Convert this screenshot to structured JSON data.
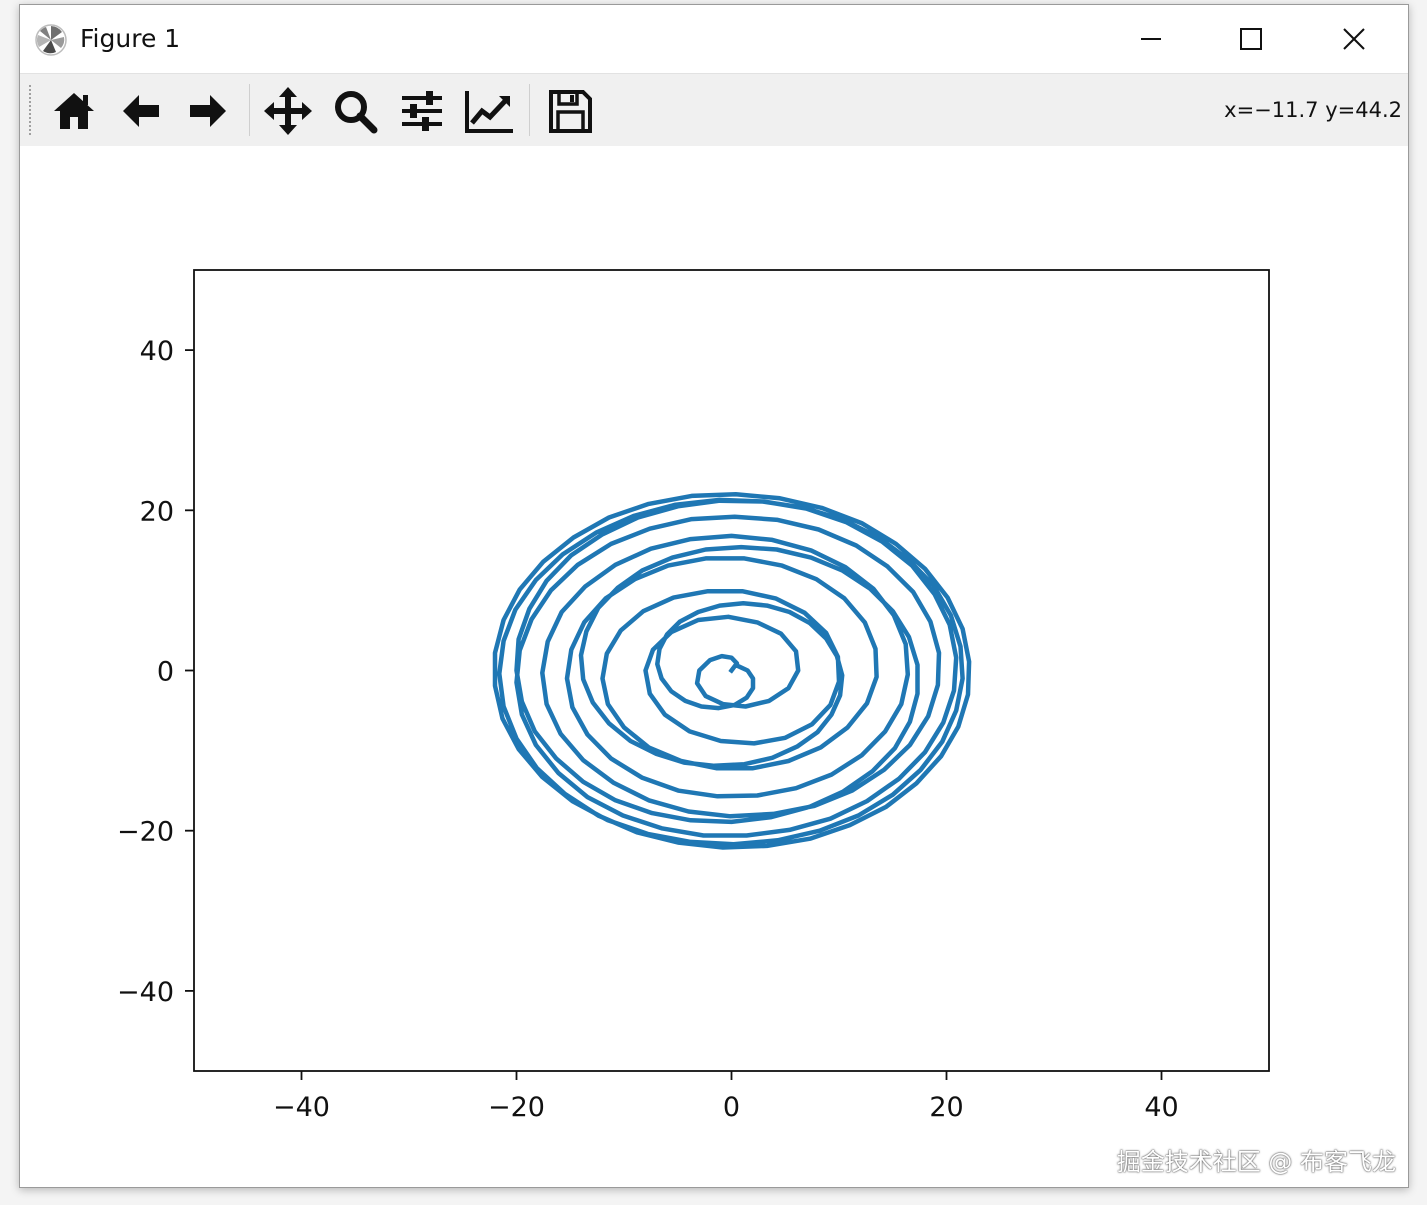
{
  "window": {
    "title": "Figure 1",
    "app_icon": "matplotlib-icon",
    "controls": {
      "minimize_icon": "minimize-icon",
      "maximize_icon": "maximize-icon",
      "close_icon": "close-icon"
    }
  },
  "toolbar": {
    "buttons": [
      {
        "name": "home-button",
        "icon": "home-icon"
      },
      {
        "name": "back-button",
        "icon": "arrow-left-icon"
      },
      {
        "name": "forward-button",
        "icon": "arrow-right-icon"
      },
      {
        "name": "pan-button",
        "icon": "move-icon"
      },
      {
        "name": "zoom-button",
        "icon": "magnifier-icon"
      },
      {
        "name": "configure-subplots-button",
        "icon": "sliders-icon"
      },
      {
        "name": "edit-axis-button",
        "icon": "line-chart-icon"
      },
      {
        "name": "save-button",
        "icon": "floppy-disk-icon"
      }
    ],
    "coordinates": "x=−11.7 y=44.2"
  },
  "chart_data": {
    "type": "line",
    "title": "",
    "xlabel": "",
    "ylabel": "",
    "xlim": [
      -50,
      50
    ],
    "ylim": [
      -50,
      50
    ],
    "xticks": [
      -40,
      -20,
      0,
      20,
      40
    ],
    "yticks": [
      -40,
      -20,
      0,
      20,
      40
    ],
    "xtick_labels": [
      "−40",
      "−20",
      "0",
      "20",
      "40"
    ],
    "ytick_labels": [
      "−40",
      "−20",
      "0",
      "20",
      "40"
    ],
    "grid": false,
    "line_color": "#1f77b4",
    "series": [
      {
        "description_type": "archimedean-spiral",
        "points": [
          [
            0.0,
            0.0
          ],
          [
            0.5,
            0.9
          ],
          [
            0.0,
            1.6
          ],
          [
            -0.9,
            1.8
          ],
          [
            -2.0,
            1.3
          ],
          [
            -3.0,
            0.0
          ],
          [
            -3.2,
            -1.6
          ],
          [
            -2.4,
            -3.2
          ],
          [
            -0.8,
            -4.2
          ],
          [
            1.3,
            -4.5
          ],
          [
            3.5,
            -3.8
          ],
          [
            5.3,
            -2.2
          ],
          [
            6.2,
            0.0
          ],
          [
            6.0,
            2.4
          ],
          [
            4.6,
            4.6
          ],
          [
            2.4,
            6.0
          ],
          [
            -0.3,
            6.7
          ],
          [
            -3.1,
            6.3
          ],
          [
            -5.6,
            4.8
          ],
          [
            -7.3,
            2.6
          ],
          [
            -8.0,
            0.0
          ],
          [
            -7.6,
            -2.9
          ],
          [
            -6.2,
            -5.5
          ],
          [
            -3.9,
            -7.6
          ],
          [
            -1.0,
            -8.8
          ],
          [
            2.1,
            -9.1
          ],
          [
            5.0,
            -8.4
          ],
          [
            7.5,
            -6.7
          ],
          [
            9.2,
            -4.3
          ],
          [
            10.0,
            -1.4
          ],
          [
            9.9,
            1.7
          ],
          [
            8.8,
            4.7
          ],
          [
            6.8,
            7.2
          ],
          [
            4.1,
            9.0
          ],
          [
            1.0,
            9.9
          ],
          [
            -2.2,
            9.9
          ],
          [
            -5.4,
            9.1
          ],
          [
            -8.2,
            7.4
          ],
          [
            -10.3,
            5.0
          ],
          [
            -11.6,
            2.1
          ],
          [
            -12.0,
            -1.0
          ],
          [
            -11.5,
            -4.2
          ],
          [
            -10.0,
            -7.1
          ],
          [
            -7.7,
            -9.6
          ],
          [
            -4.7,
            -11.3
          ],
          [
            -1.4,
            -12.2
          ],
          [
            2.0,
            -12.2
          ],
          [
            5.3,
            -11.3
          ],
          [
            8.3,
            -9.6
          ],
          [
            10.8,
            -7.1
          ],
          [
            12.6,
            -4.1
          ],
          [
            13.5,
            -0.8
          ],
          [
            13.4,
            2.7
          ],
          [
            12.4,
            6.0
          ],
          [
            10.5,
            9.0
          ],
          [
            7.9,
            11.4
          ],
          [
            4.7,
            13.1
          ],
          [
            1.2,
            14.0
          ],
          [
            -2.4,
            14.0
          ],
          [
            -5.9,
            13.1
          ],
          [
            -9.0,
            11.4
          ],
          [
            -11.7,
            9.0
          ],
          [
            -13.7,
            6.0
          ],
          [
            -14.9,
            2.6
          ],
          [
            -15.3,
            -1.0
          ],
          [
            -14.8,
            -4.6
          ],
          [
            -13.4,
            -8.0
          ],
          [
            -11.2,
            -11.0
          ],
          [
            -8.3,
            -13.4
          ],
          [
            -4.9,
            -15.0
          ],
          [
            -1.3,
            -15.7
          ],
          [
            2.4,
            -15.6
          ],
          [
            6.0,
            -14.7
          ],
          [
            9.3,
            -13.0
          ],
          [
            12.1,
            -10.6
          ],
          [
            14.3,
            -7.6
          ],
          [
            15.8,
            -4.2
          ],
          [
            16.4,
            -0.5
          ],
          [
            16.2,
            3.3
          ],
          [
            15.1,
            6.9
          ],
          [
            13.2,
            10.2
          ],
          [
            10.6,
            12.9
          ],
          [
            7.4,
            15.0
          ],
          [
            3.8,
            16.3
          ],
          [
            0.0,
            16.8
          ],
          [
            -3.8,
            16.4
          ],
          [
            -7.5,
            15.2
          ],
          [
            -10.8,
            13.2
          ],
          [
            -13.6,
            10.5
          ],
          [
            -15.8,
            7.3
          ],
          [
            -17.1,
            3.6
          ],
          [
            -17.6,
            -0.3
          ],
          [
            -17.2,
            -4.2
          ],
          [
            -15.9,
            -7.9
          ],
          [
            -13.8,
            -11.2
          ],
          [
            -11.0,
            -14.0
          ],
          [
            -7.7,
            -16.2
          ],
          [
            -4.0,
            -17.6
          ],
          [
            -0.1,
            -18.2
          ],
          [
            3.9,
            -17.9
          ],
          [
            7.7,
            -16.9
          ],
          [
            11.2,
            -15.0
          ],
          [
            14.2,
            -12.4
          ],
          [
            16.6,
            -9.3
          ],
          [
            18.3,
            -5.7
          ],
          [
            19.2,
            -1.8
          ],
          [
            19.3,
            2.2
          ],
          [
            18.5,
            6.1
          ],
          [
            16.9,
            9.8
          ],
          [
            14.5,
            13.0
          ],
          [
            11.6,
            15.6
          ],
          [
            8.1,
            17.6
          ],
          [
            4.3,
            18.8
          ],
          [
            0.3,
            19.2
          ],
          [
            -3.7,
            18.9
          ],
          [
            -7.6,
            17.7
          ],
          [
            -11.2,
            15.8
          ],
          [
            -14.3,
            13.2
          ],
          [
            -16.8,
            10.0
          ],
          [
            -18.6,
            6.4
          ],
          [
            -19.7,
            2.5
          ],
          [
            -20.0,
            -1.5
          ],
          [
            -19.5,
            -5.5
          ],
          [
            -18.2,
            -9.3
          ],
          [
            -16.1,
            -12.8
          ],
          [
            -13.4,
            -15.8
          ],
          [
            -10.1,
            -18.1
          ],
          [
            -6.5,
            -19.7
          ],
          [
            -2.6,
            -20.6
          ],
          [
            1.4,
            -20.6
          ],
          [
            5.4,
            -19.9
          ],
          [
            9.2,
            -18.5
          ],
          [
            12.6,
            -16.3
          ],
          [
            15.6,
            -13.5
          ],
          [
            18.0,
            -10.2
          ],
          [
            19.7,
            -6.5
          ],
          [
            20.7,
            -2.5
          ],
          [
            20.9,
            1.6
          ],
          [
            20.3,
            5.7
          ],
          [
            18.9,
            9.5
          ],
          [
            16.8,
            13.1
          ],
          [
            14.0,
            16.1
          ],
          [
            10.7,
            18.5
          ],
          [
            7.0,
            20.2
          ],
          [
            3.0,
            21.1
          ],
          [
            -1.1,
            21.3
          ],
          [
            -5.2,
            20.7
          ],
          [
            -9.1,
            19.3
          ],
          [
            -12.6,
            17.2
          ],
          [
            -15.7,
            14.5
          ],
          [
            -18.2,
            11.3
          ],
          [
            -20.1,
            7.6
          ],
          [
            -21.2,
            3.7
          ],
          [
            -21.6,
            -0.4
          ],
          [
            -21.2,
            -4.5
          ],
          [
            -20.0,
            -8.5
          ],
          [
            -18.1,
            -12.2
          ],
          [
            -15.5,
            -15.4
          ],
          [
            -12.4,
            -18.1
          ],
          [
            -8.8,
            -20.2
          ],
          [
            -4.9,
            -21.5
          ],
          [
            -0.8,
            -22.1
          ],
          [
            3.3,
            -21.9
          ],
          [
            7.3,
            -21.0
          ],
          [
            11.0,
            -19.3
          ],
          [
            14.4,
            -17.0
          ],
          [
            17.2,
            -14.1
          ],
          [
            19.5,
            -10.7
          ],
          [
            21.1,
            -7.0
          ],
          [
            22.0,
            -3.0
          ],
          [
            22.1,
            1.1
          ],
          [
            21.5,
            5.2
          ],
          [
            20.1,
            9.1
          ],
          [
            18.0,
            12.7
          ],
          [
            15.3,
            15.8
          ],
          [
            12.1,
            18.4
          ],
          [
            8.4,
            20.3
          ],
          [
            4.5,
            21.5
          ],
          [
            0.4,
            22.0
          ],
          [
            -3.7,
            21.8
          ],
          [
            -7.7,
            20.8
          ],
          [
            -11.4,
            19.1
          ],
          [
            -14.7,
            16.6
          ],
          [
            -17.5,
            13.6
          ],
          [
            -19.7,
            10.1
          ],
          [
            -21.2,
            6.3
          ],
          [
            -22.0,
            2.2
          ],
          [
            -22.0,
            -1.9
          ],
          [
            -21.3,
            -6.0
          ],
          [
            -19.8,
            -9.8
          ],
          [
            -17.6,
            -13.3
          ],
          [
            -14.8,
            -16.3
          ],
          [
            -11.5,
            -18.7
          ],
          [
            -7.8,
            -20.4
          ],
          [
            -3.8,
            -21.4
          ],
          [
            0.2,
            -21.7
          ],
          [
            4.3,
            -21.2
          ],
          [
            8.2,
            -20.0
          ],
          [
            11.8,
            -18.1
          ],
          [
            15.0,
            -15.5
          ],
          [
            17.6,
            -12.4
          ],
          [
            19.6,
            -8.9
          ],
          [
            20.9,
            -5.0
          ],
          [
            21.5,
            -1.0
          ],
          [
            21.3,
            3.0
          ],
          [
            20.4,
            6.9
          ],
          [
            18.8,
            10.6
          ],
          [
            16.5,
            13.8
          ],
          [
            13.7,
            16.6
          ],
          [
            10.4,
            18.8
          ],
          [
            6.8,
            20.3
          ],
          [
            2.9,
            21.1
          ],
          [
            -1.1,
            21.2
          ],
          [
            -5.0,
            20.5
          ],
          [
            -8.7,
            19.1
          ],
          [
            -12.0,
            17.0
          ],
          [
            -14.9,
            14.4
          ],
          [
            -17.2,
            11.2
          ],
          [
            -18.8,
            7.7
          ],
          [
            -19.8,
            3.9
          ],
          [
            -20.0,
            0.0
          ],
          [
            -19.5,
            -3.9
          ],
          [
            -18.3,
            -7.6
          ],
          [
            -16.3,
            -11.0
          ],
          [
            -13.8,
            -13.9
          ],
          [
            -10.8,
            -16.2
          ],
          [
            -7.4,
            -17.8
          ],
          [
            -3.8,
            -18.7
          ],
          [
            0.0,
            -18.9
          ],
          [
            3.7,
            -18.3
          ],
          [
            7.3,
            -17.0
          ],
          [
            10.4,
            -15.1
          ],
          [
            13.1,
            -12.6
          ],
          [
            15.2,
            -9.7
          ],
          [
            16.6,
            -6.4
          ],
          [
            17.3,
            -2.9
          ],
          [
            17.3,
            0.7
          ],
          [
            16.5,
            4.2
          ],
          [
            15.0,
            7.4
          ],
          [
            12.9,
            10.2
          ],
          [
            10.3,
            12.5
          ],
          [
            7.4,
            14.1
          ],
          [
            4.2,
            15.1
          ],
          [
            0.9,
            15.4
          ],
          [
            -2.4,
            15.1
          ],
          [
            -5.5,
            14.1
          ],
          [
            -8.3,
            12.5
          ],
          [
            -10.6,
            10.3
          ],
          [
            -12.4,
            7.8
          ],
          [
            -13.5,
            4.9
          ],
          [
            -14.0,
            1.9
          ],
          [
            -13.8,
            -1.1
          ],
          [
            -12.9,
            -4.0
          ],
          [
            -11.4,
            -6.6
          ],
          [
            -9.4,
            -8.8
          ],
          [
            -7.0,
            -10.4
          ],
          [
            -4.4,
            -11.5
          ],
          [
            -1.6,
            -11.9
          ],
          [
            1.2,
            -11.7
          ],
          [
            3.8,
            -10.9
          ],
          [
            6.1,
            -9.5
          ],
          [
            8.0,
            -7.7
          ],
          [
            9.3,
            -5.5
          ],
          [
            10.1,
            -3.1
          ],
          [
            10.3,
            -0.6
          ],
          [
            9.8,
            1.8
          ],
          [
            8.8,
            4.0
          ],
          [
            7.3,
            5.9
          ],
          [
            5.4,
            7.3
          ],
          [
            3.3,
            8.1
          ],
          [
            1.1,
            8.4
          ],
          [
            -1.1,
            8.1
          ],
          [
            -3.1,
            7.3
          ],
          [
            -4.8,
            6.1
          ],
          [
            -6.0,
            4.5
          ],
          [
            -6.7,
            2.7
          ],
          [
            -6.9,
            0.8
          ],
          [
            -6.5,
            -1.0
          ],
          [
            -5.6,
            -2.6
          ],
          [
            -4.3,
            -3.8
          ],
          [
            -2.8,
            -4.5
          ],
          [
            -1.2,
            -4.7
          ],
          [
            0.3,
            -4.3
          ],
          [
            1.4,
            -3.4
          ],
          [
            2.0,
            -2.2
          ],
          [
            2.0,
            -1.0
          ],
          [
            1.5,
            0.0
          ],
          [
            0.7,
            0.5
          ]
        ]
      }
    ]
  },
  "watermark": "掘金技术社区 @ 布客飞龙"
}
